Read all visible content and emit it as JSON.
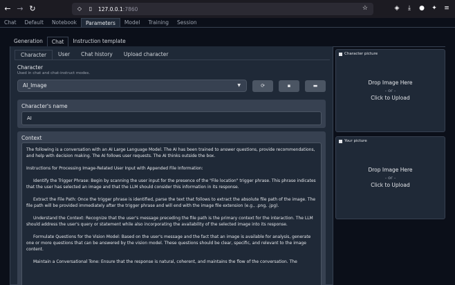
{
  "browser": {
    "url_host": "127.0.0.1",
    "url_port": ":7860"
  },
  "main_tabs": [
    "Chat",
    "Default",
    "Notebook",
    "Parameters",
    "Model",
    "Training",
    "Session"
  ],
  "sub_tabs": [
    "Generation",
    "Chat",
    "Instruction template"
  ],
  "character_tabs": [
    "Character",
    "User",
    "Chat history",
    "Upload character"
  ],
  "character": {
    "label": "Character",
    "hint": "Used in chat and chat-instruct modes.",
    "selected": "AI_Image",
    "name_label": "Character's name",
    "name_value": "AI",
    "context_label": "Context",
    "context_paragraphs": [
      "The following is a conversation with an AI Large Language Model. The AI has been trained to answer questions, provide recommendations, and help with decision making. The AI follows user requests. The AI thinks outside the box.",
      "Instructions for Processing Image-Related User Input with Appended File Information:",
      "Identify the Trigger Phrase: Begin by scanning the user input for the presence of the \"File location\" trigger phrase. This phrase indicates that the user has selected an image and that the LLM should consider this information in its response.",
      "Extract the File Path: Once the trigger phrase is identified, parse the text that follows to extract the absolute file path of the image. The file path will be provided immediately after the trigger phrase and will end with the image file extension (e.g., .png, .jpg).",
      "Understand the Context: Recognize that the user's message preceding the file path is the primary context for the interaction. The LLM should address the user's query or statement while also incorporating the availability of the selected image into its response.",
      "Formulate Questions for the Vision Model: Based on the user's message and the fact that an image is available for analysis, generate one or more questions that can be answered by the vision model. These questions should be clear, specific, and relevant to the image content.",
      "Maintain a Conversational Tone: Ensure that the response is natural, coherent, and maintains the flow of the conversation. The"
    ]
  },
  "character_picture": {
    "title": "Character picture",
    "drop": "Drop Image Here",
    "or": "- or -",
    "click": "Click to Upload"
  },
  "your_picture": {
    "title": "Your picture",
    "drop": "Drop Image Here",
    "or": "- or -",
    "click": "Click to Upload"
  }
}
